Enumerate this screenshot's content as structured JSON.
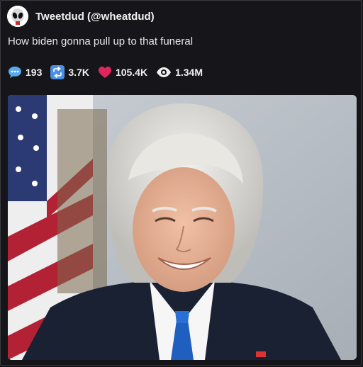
{
  "author": {
    "display": "Tweetdud (@wheatdud)"
  },
  "tweet": {
    "text": "How biden gonna pull up to that funeral"
  },
  "stats": {
    "comments": "193",
    "retweets": "3.7K",
    "likes": "105.4K",
    "views": "1.34M"
  },
  "colors": {
    "comment_icon": "#5aa9f0",
    "retweet_icon": "#4a90e2",
    "like_icon": "#e0245e",
    "view_icon": "#f0f0f0"
  },
  "icons": [
    "alien-avatar",
    "comment-icon",
    "retweet-icon",
    "heart-icon",
    "eye-icon"
  ],
  "image": {
    "alt": ""
  }
}
